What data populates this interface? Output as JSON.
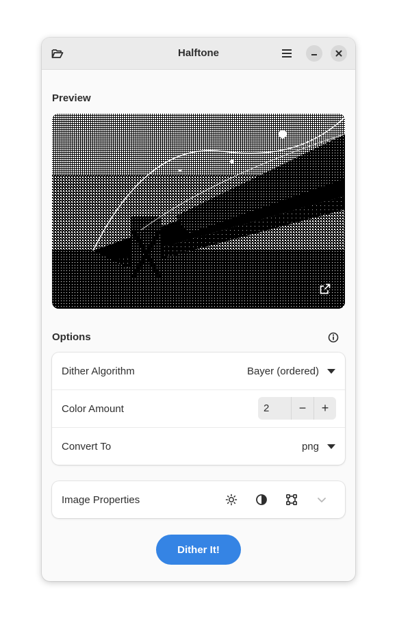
{
  "window": {
    "title": "Halftone"
  },
  "headerbar": {
    "open_icon": "folder-open-icon",
    "menu_icon": "hamburger-menu-icon",
    "minimize_icon": "minimize-icon",
    "close_icon": "close-icon"
  },
  "preview": {
    "label": "Preview",
    "open_external_icon": "open-external-icon"
  },
  "options": {
    "label": "Options",
    "info_icon": "info-icon",
    "dither_algorithm": {
      "label": "Dither Algorithm",
      "value": "Bayer (ordered)"
    },
    "color_amount": {
      "label": "Color Amount",
      "value": "2",
      "decrement": "−",
      "increment": "+"
    },
    "convert_to": {
      "label": "Convert To",
      "value": "png"
    }
  },
  "image_properties": {
    "label": "Image Properties",
    "icons": [
      "brightness-icon",
      "contrast-icon",
      "crop-icon",
      "expand-chevron-icon"
    ]
  },
  "actions": {
    "dither_label": "Dither It!"
  },
  "colors": {
    "accent": "#3584e4",
    "window_bg": "#fafafa",
    "headerbar_bg": "#ebebeb"
  }
}
